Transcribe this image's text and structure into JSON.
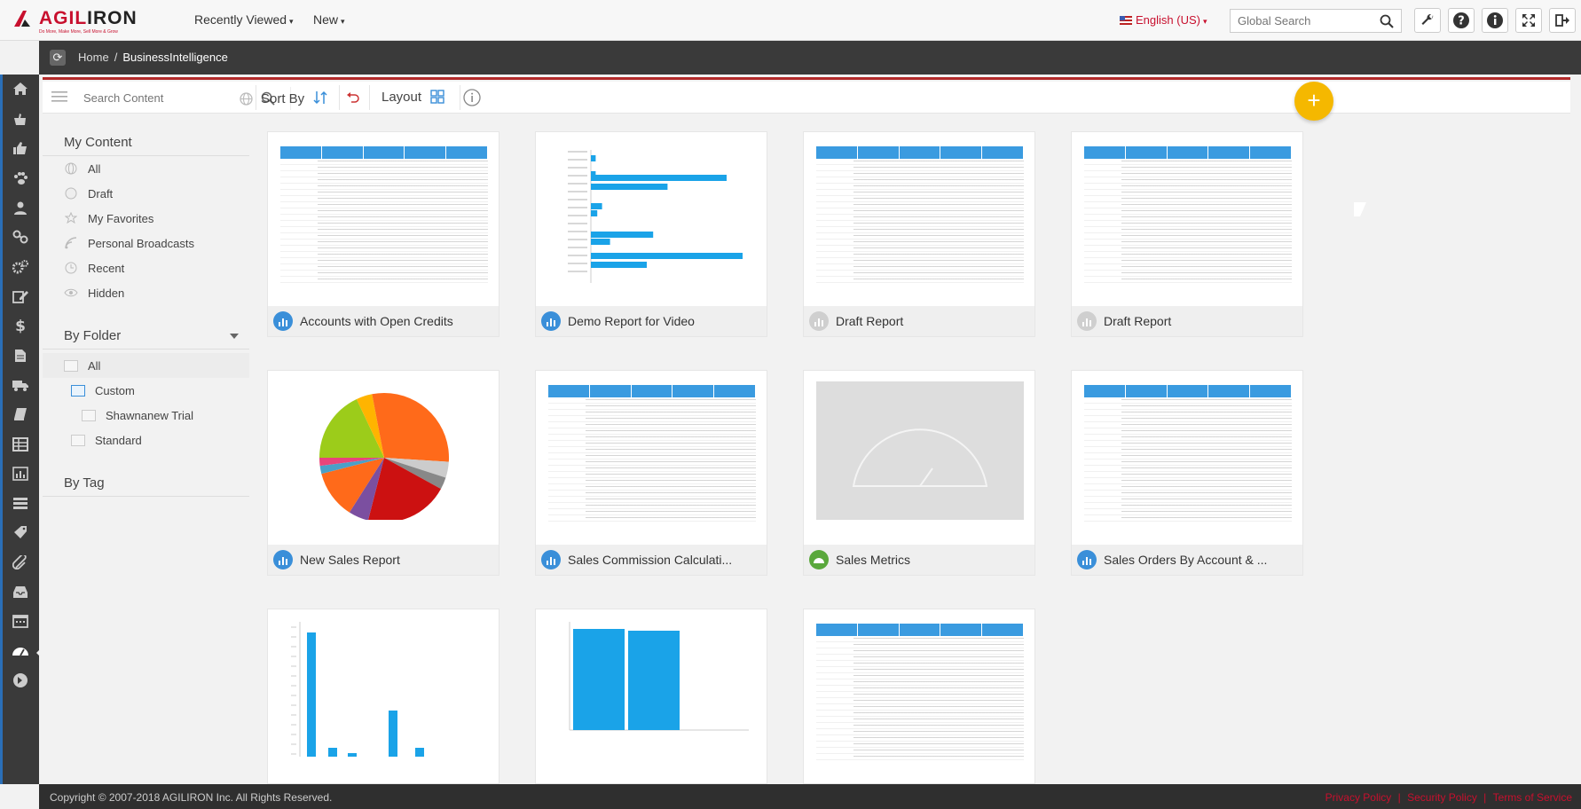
{
  "app": {
    "logo_text_a": "AGIL",
    "logo_text_b": "IRON",
    "logo_tagline": "Do More, Make More, Sell More & Grow",
    "recently_viewed": "Recently Viewed",
    "new": "New",
    "language": "English (US)",
    "global_search_placeholder": "Global Search"
  },
  "breadcrumb": {
    "home": "Home",
    "separator": "/",
    "current": "BusinessIntelligence"
  },
  "toolbar": {
    "search_placeholder": "Search Content",
    "sort_by": "Sort By",
    "layout": "Layout"
  },
  "left_panel": {
    "my_content_title": "My Content",
    "my_content_items": [
      "All",
      "Draft",
      "My Favorites",
      "Personal Broadcasts",
      "Recent",
      "Hidden"
    ],
    "by_folder_title": "By Folder",
    "folder_items": [
      "All",
      "Custom",
      "Shawnanew Trial",
      "Standard"
    ],
    "by_tag_title": "By Tag"
  },
  "tiles": [
    {
      "title": "Accounts with Open Credits",
      "icon": "bar-chart-icon",
      "icon_color": "#3a8fd9",
      "thumb": "table"
    },
    {
      "title": "Demo Report for Video",
      "icon": "bar-chart-icon",
      "icon_color": "#3a8fd9",
      "thumb": "hbar"
    },
    {
      "title": "Draft Report",
      "icon": "bar-chart-icon",
      "icon_color": "#cfcfcf",
      "thumb": "table"
    },
    {
      "title": "Draft Report",
      "icon": "bar-chart-icon",
      "icon_color": "#cfcfcf",
      "thumb": "table"
    },
    {
      "title": "New Sales Report",
      "icon": "bar-chart-icon",
      "icon_color": "#3a8fd9",
      "thumb": "pie"
    },
    {
      "title": "Sales Commission Calculati...",
      "icon": "bar-chart-icon",
      "icon_color": "#3a8fd9",
      "thumb": "table"
    },
    {
      "title": "Sales Metrics",
      "icon": "gauge-icon",
      "icon_color": "#5aa83c",
      "thumb": "gauge"
    },
    {
      "title": "Sales Orders By Account & ...",
      "icon": "bar-chart-icon",
      "icon_color": "#3a8fd9",
      "thumb": "table"
    },
    {
      "title": "",
      "icon": "",
      "icon_color": "",
      "thumb": "vbar"
    },
    {
      "title": "",
      "icon": "",
      "icon_color": "",
      "thumb": "vbar2"
    },
    {
      "title": "",
      "icon": "",
      "icon_color": "",
      "thumb": "table"
    }
  ],
  "footer": {
    "copyright": "Copyright © 2007-2018 AGILIRON Inc. All Rights Reserved.",
    "privacy": "Privacy Policy",
    "security": "Security Policy",
    "terms": "Terms of Service",
    "sep": "|"
  },
  "colors": {
    "accent_blue": "#3a8fd9",
    "brand_red": "#c8102e",
    "fab_yellow": "#f5b800",
    "chart_blue": "#1aa3e8"
  }
}
